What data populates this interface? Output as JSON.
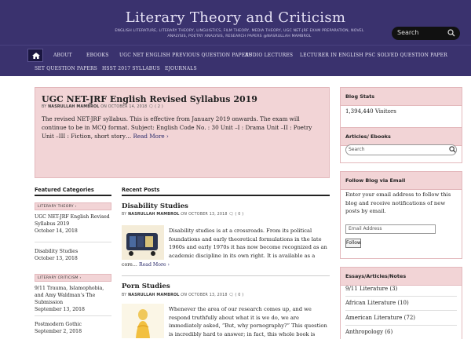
{
  "site": {
    "title": "Literary Theory and Criticism",
    "tagline": "ENGLISH LITERATURE, LITERARY THEORY, LINGUISTICS, FILM THEORY, MEDIA THEORY, UGC NET-JRF EXAM PREPARATION, NOVEL ANALYSIS, POETRY ANALYSIS, RESEARCH PAPERS @NASRULLAH MAMBROL",
    "search_placeholder": "Search"
  },
  "nav": {
    "items": [
      "ABOUT",
      "EBOOKS",
      "UGC NET ENGLISH PREVIOUS QUESTION PAPERS",
      "AUDIO LECTURES",
      "LECTURER IN ENGLISH PSC SOLVED QUESTION PAPER",
      "SET QUESTION PAPERS",
      "HSST 2017 SYLLABUS",
      "EJOURNALS"
    ]
  },
  "sticky_post": {
    "title": "UGC NET-JRF English Revised Syllabus 2019",
    "meta_by": "BY",
    "author": "NASRULLAH MAMBROL",
    "meta_on": "ON",
    "date": "OCTOBER 14, 2018",
    "comments": "( 2 )",
    "excerpt": "The revised NET-JRF syllabus. This is effective from January 2019 onwards. The exam will continue to be in MCQ format. Subject: English Code No. : 30 Unit –I :    Drama Unit –II :   Poetry Unit –III :  Fiction, short story…",
    "read_more": "Read More ›"
  },
  "featured": {
    "heading": "Featured Categories",
    "cats": [
      {
        "label": "LITERARY THEORY ›",
        "items": [
          {
            "title": "UGC NET-JRF English Revised Syllabus 2019",
            "date": "October 14, 2018"
          },
          {
            "title": "Disability Studies",
            "date": "October 13, 2018"
          }
        ]
      },
      {
        "label": "LITERARY CRITICISM ›",
        "items": [
          {
            "title": "9/11 Trauma, Islamophobia, and Amy Waldman’s The Submission",
            "date": "September 13, 2018"
          },
          {
            "title": "Postmodern Gothic",
            "date": "September 2, 2018"
          }
        ]
      }
    ]
  },
  "recent": {
    "heading": "Recent Posts",
    "posts": [
      {
        "title": "Disability Studies",
        "author": "NASRULLAH MAMBROL",
        "date": "OCTOBER 13, 2018",
        "comments": "( 0 )",
        "excerpt": "Disability studies is at a crossroads. From its political foundations and early theoretical formulations in the late 1960s and early 1970s it has now become recognized as an academic discipline in its own right. It is available as a",
        "tail": "core…",
        "read_more": "Read More ›"
      },
      {
        "title": "Porn Studies",
        "author": "NASRULLAH MAMBROL",
        "date": "OCTOBER 13, 2018",
        "comments": "( 0 )",
        "excerpt": "Whenever the area of our research comes up, and we respond truthfully about what it is we do, we are immediately asked, “But, why pornography?” This question is incredibly hard to answer; in fact, this whole book is"
      }
    ]
  },
  "sidebar": {
    "stats": {
      "heading": "Blog Stats",
      "visitors": "1,394,440 Visitors"
    },
    "articles": {
      "heading": "Articles/ Ebooks",
      "search_placeholder": "Search"
    },
    "follow": {
      "heading": "Follow Blog via Email",
      "text": "Enter your email address to follow this blog and receive notifications of new posts by email.",
      "email_placeholder": "Email Address",
      "button": "Follow"
    },
    "essays": {
      "heading": "Essays/Articles/Notes",
      "items": [
        "9/11 Literature (3)",
        "African Literature (10)",
        "American Literature (72)",
        "Anthropology (6)"
      ]
    }
  },
  "colors": {
    "header": "#3a326e",
    "pink": "#f2d4d6",
    "pink_border": "#e3b8bc"
  }
}
